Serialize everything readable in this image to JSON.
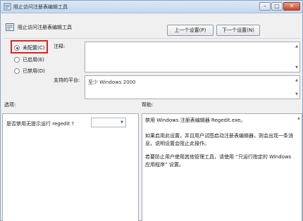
{
  "window": {
    "title": "阻止访问注册表编辑工具",
    "icons": {
      "title": "policy-icon",
      "policy": "settings-page-icon"
    },
    "colors": {
      "highlight": "#e0221e",
      "close": "#c8452a"
    }
  },
  "header": {
    "policy_name": "阻止访问注册表编辑工具",
    "prev_button": "上一个设置(P)",
    "next_button": "下一个设置(N)"
  },
  "state": {
    "selected": "not_configured",
    "options": [
      {
        "id": "not_configured",
        "label": "未配置(C)"
      },
      {
        "id": "enabled",
        "label": "已启用(E)"
      },
      {
        "id": "disabled",
        "label": "已禁用(D)"
      }
    ]
  },
  "comment": {
    "label": "注释:",
    "value": ""
  },
  "platform": {
    "label": "支持的平台:",
    "value": "至少 Windows 2000"
  },
  "options_section": {
    "label": "选项:",
    "item_label": "是否禁用无提示运行 regedit ?",
    "combo_value": ""
  },
  "help_section": {
    "label": "帮助:",
    "paragraphs": [
      "禁用 Windows 注册表编辑器 Regedit.exe。",
      "如果启用此设置，并且用户试图启动注册表编辑器，则会出现一条消息，说明设置会阻止此操作。",
      "若要防止用户使用其他管理工具，请使用 “只运行指定的 Windows 应用程序” 设置。"
    ]
  }
}
